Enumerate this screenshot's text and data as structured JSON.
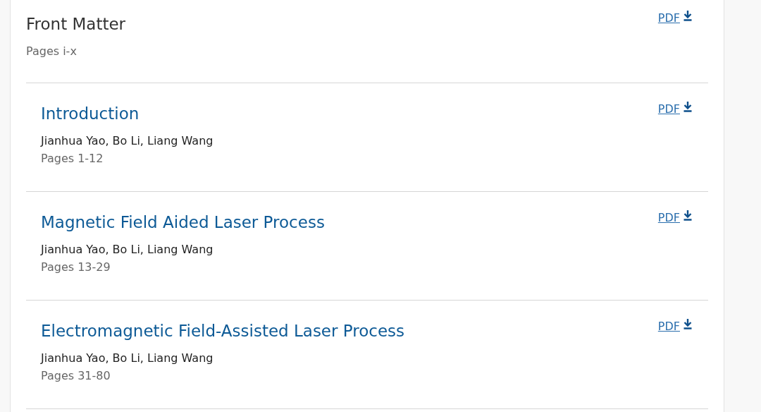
{
  "front_matter": {
    "title": "Front Matter",
    "pages": "Pages i-x",
    "pdf_label": "PDF"
  },
  "chapters": [
    {
      "title": "Introduction",
      "authors": "Jianhua Yao, Bo Li, Liang Wang",
      "pages": "Pages 1-12",
      "pdf_label": "PDF"
    },
    {
      "title": "Magnetic Field Aided Laser Process",
      "authors": "Jianhua Yao, Bo Li, Liang Wang",
      "pages": "Pages 13-29",
      "pdf_label": "PDF"
    },
    {
      "title": "Electromagnetic Field-Assisted Laser Process",
      "authors": "Jianhua Yao, Bo Li, Liang Wang",
      "pages": "Pages 31-80",
      "pdf_label": "PDF"
    }
  ]
}
